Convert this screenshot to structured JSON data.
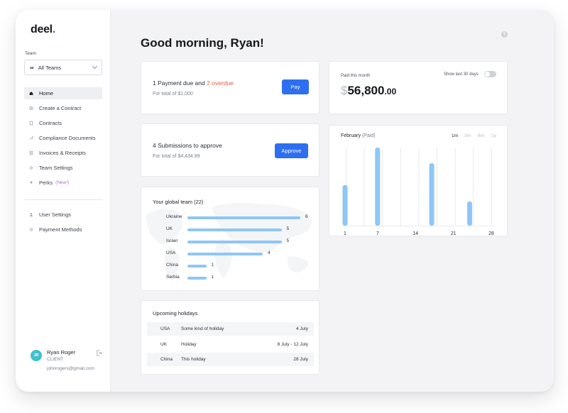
{
  "brand": {
    "name": "deel",
    "dot": "."
  },
  "sidebar": {
    "team_label": "Team",
    "team_select": {
      "icon": "infinity-icon",
      "value": "All Teams"
    },
    "nav": [
      {
        "label": "Home",
        "icon": "home-icon",
        "active": true
      },
      {
        "label": "Create a Contract",
        "icon": "plus-circle-icon"
      },
      {
        "label": "Contracts",
        "icon": "document-icon"
      },
      {
        "label": "Compliance Documents",
        "icon": "wrench-icon"
      },
      {
        "label": "Invoices & Receipts",
        "icon": "receipt-icon"
      },
      {
        "label": "Team Settings",
        "icon": "gear-icon"
      },
      {
        "label": "Perks",
        "icon": "star-icon",
        "badge": "(New!)"
      }
    ],
    "nav2": [
      {
        "label": "User Settings",
        "icon": "user-icon"
      },
      {
        "label": "Payment Methods",
        "icon": "gear-icon"
      }
    ],
    "user": {
      "initials": "JR",
      "name": "Ryan Roger",
      "role": "CLIENT",
      "email": "johnrogers@gmail.com"
    }
  },
  "main": {
    "greeting": "Good morning, Ryan!",
    "payment_card": {
      "title": "1 Payment due and ",
      "overdue": "2 overdue",
      "subtitle": "For total of $1,000",
      "button": "Pay"
    },
    "submissions_card": {
      "title": "4 Submissions to approve",
      "subtitle": "For total of $4,434.89",
      "button": "Approve"
    },
    "global_team": {
      "title": "Your global team (22)",
      "rows": [
        {
          "country": "Ukraine",
          "count": 6
        },
        {
          "country": "UK",
          "count": 5
        },
        {
          "country": "Israel",
          "count": 5
        },
        {
          "country": "USA",
          "count": 4
        },
        {
          "country": "China",
          "count": 1
        },
        {
          "country": "Serbia",
          "count": 1
        }
      ]
    },
    "holidays": {
      "title": "Upcoming holidays",
      "rows": [
        {
          "country": "USA",
          "name": "Some kind of holiday",
          "date": "4 July"
        },
        {
          "country": "UK",
          "name": "Holiday",
          "date": "8 July - 12 July"
        },
        {
          "country": "China",
          "name": "This holiday",
          "date": "28 July"
        }
      ]
    },
    "paid_card": {
      "label": "Paid this month",
      "currency": "$",
      "amount": "56,800",
      "decimals": ".00",
      "toggle_label": "Show last 30 days",
      "toggle_on": false
    },
    "monthly_chart": {
      "month": "February",
      "paid": "(Paid)",
      "ranges": [
        {
          "label": "1m",
          "active": true
        },
        {
          "label": "3m"
        },
        {
          "label": "6m"
        },
        {
          "label": "1y"
        }
      ]
    }
  },
  "colors": {
    "accent": "#2e6ff1",
    "bar": "#8ec6f7",
    "overdue": "#ec5a43",
    "avatar": "#3fc0cf",
    "perks_new": "#b36fd6"
  },
  "chart_data": {
    "type": "bar",
    "title": "February (Paid)",
    "x_ticks": [
      1,
      7,
      14,
      21,
      28
    ],
    "xlim": [
      1,
      28
    ],
    "ylim": [
      0,
      1
    ],
    "grid": "vertical",
    "x": [
      1,
      7,
      17,
      24
    ],
    "values": [
      0.52,
      1.0,
      0.8,
      0.31
    ]
  }
}
